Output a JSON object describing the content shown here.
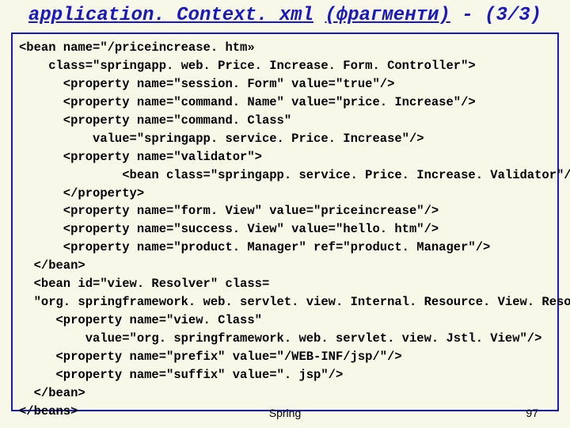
{
  "title": {
    "file": "application. Context. xml",
    "part": "(фрагменти)",
    "page": "- (3/3)"
  },
  "code": {
    "l01": "<bean name=\"/priceincrease. htm»",
    "l02": "    class=\"springapp. web. Price. Increase. Form. Controller\">",
    "l03": "      <property name=\"session. Form\" value=\"true\"/>",
    "l04": "      <property name=\"command. Name\" value=\"price. Increase\"/>",
    "l05": "      <property name=\"command. Class\"",
    "l06": "          value=\"springapp. service. Price. Increase\"/>",
    "l07": "      <property name=\"validator\">",
    "l08": "              <bean class=\"springapp. service. Price. Increase. Validator\"/>",
    "l09": "      </property>",
    "l10": "      <property name=\"form. View\" value=\"priceincrease\"/>",
    "l11": "      <property name=\"success. View\" value=\"hello. htm\"/>",
    "l12": "      <property name=\"product. Manager\" ref=\"product. Manager\"/>",
    "l13": "  </bean>",
    "l14": "  <bean id=\"view. Resolver\" class=",
    "l15": "  \"org. springframework. web. servlet. view. Internal. Resource. View. Resolver\">",
    "l16": "     <property name=\"view. Class\"",
    "l17": "         value=\"org. springframework. web. servlet. view. Jstl. View\"/>",
    "l18": "     <property name=\"prefix\" value=\"/WEB-INF/jsp/\"/>",
    "l19": "     <property name=\"suffix\" value=\". jsp\"/>",
    "l20": "  </bean>",
    "l21": "</beans>"
  },
  "footer": {
    "center": "Spring",
    "number": "97"
  }
}
